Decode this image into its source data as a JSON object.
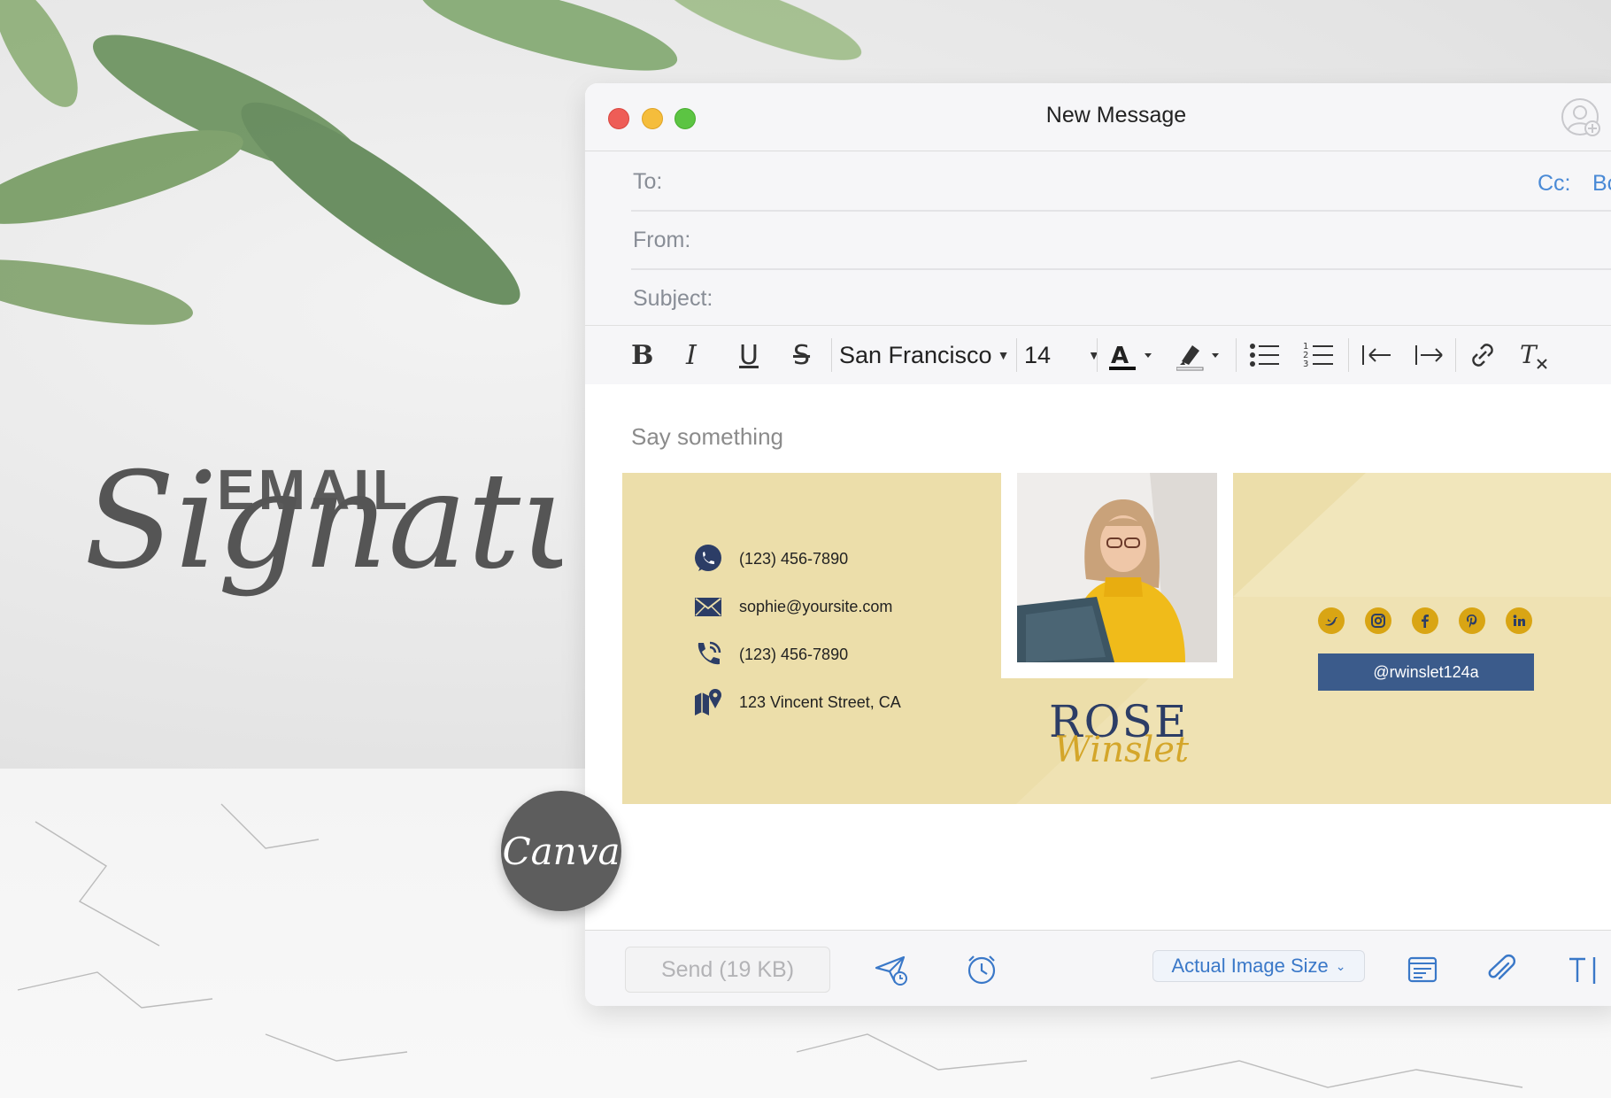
{
  "promo": {
    "headline_word": "EMAIL",
    "script_word": "Signature",
    "badge_label": "Canva"
  },
  "window": {
    "title": "New Message",
    "headers": {
      "to_label": "To:",
      "cc_label": "Cc:",
      "bcc_label": "Bcc:",
      "from_label": "From:",
      "subject_label": "Subject:"
    },
    "toolbar": {
      "bold": "B",
      "italic": "I",
      "underline": "U",
      "strike": "S",
      "font_name": "San Francisco",
      "font_size": "14"
    },
    "body_placeholder": "Say something",
    "footer": {
      "send_label": "Send (19 KB)",
      "image_size_label": "Actual Image Size"
    }
  },
  "signature": {
    "phone_1": "(123) 456-7890",
    "email": "sophie@yoursite.com",
    "phone_2": "(123) 456-7890",
    "address": "123 Vincent Street, CA",
    "first_name": "ROSE",
    "last_name": "Winslet",
    "handle": "@rwinslet124a",
    "socials": [
      "twitter-icon",
      "instagram-icon",
      "facebook-icon",
      "pinterest-icon",
      "linkedin-icon"
    ],
    "colors": {
      "background": "#ecdeaa",
      "navy": "#2c3d66",
      "gold": "#d9a514"
    }
  }
}
